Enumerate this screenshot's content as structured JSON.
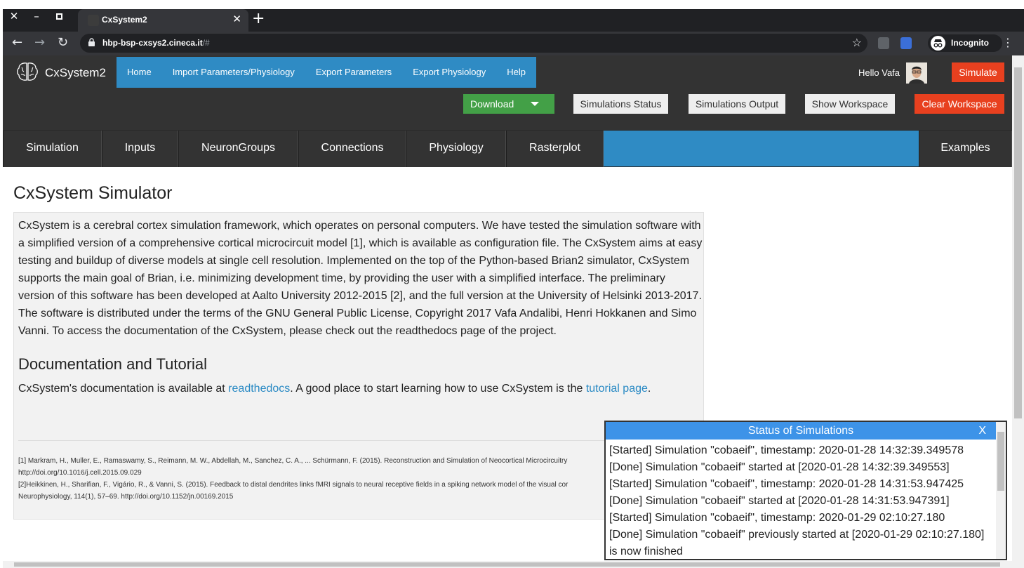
{
  "browser": {
    "tab_title": "CxSystem2",
    "url_host": "hbp-bsp-cxsys2.cineca.it",
    "url_rest": "/#",
    "profile_label": "Incognito"
  },
  "header": {
    "brand": "CxSystem2",
    "nav": [
      "Home",
      "Import Parameters/Physiology",
      "Export Parameters",
      "Export Physiology",
      "Help"
    ],
    "greeting": "Hello Vafa",
    "simulate_label": "Simulate",
    "download_label": "Download",
    "simulations_status_label": "Simulations Status",
    "simulations_output_label": "Simulations Output",
    "show_workspace_label": "Show Workspace",
    "clear_workspace_label": "Clear Workspace"
  },
  "tabs": [
    "Simulation",
    "Inputs",
    "NeuronGroups",
    "Connections",
    "Physiology",
    "Rasterplot"
  ],
  "examples_label": "Examples",
  "main": {
    "title": "CxSystem Simulator",
    "intro": "CxSystem is a cerebral cortex simulation framework, which operates on personal computers. We have tested the simulation software with a simplified version of a comprehensive cortical microcircuit model [1], which is available as configuration file. The CxSystem aims at easy testing and buildup of diverse models at single cell resolution. Implemented on the top of the Python-based Brian2 simulator, CxSystem supports the main goal of Brian, i.e. minimizing development time, by providing the user with a simplified interface. The preliminary version of this software has been developed at Aalto University 2012-2015 [2], and the full version at the University of Helsinki 2013-2017. The software is distributed under the terms of the GNU General Public License, Copyright 2017 Vafa Andalibi, Henri Hokkanen and Simo Vanni. To access the documentation of the CxSystem, please check out the readthedocs page of the project.",
    "doc_heading": "Documentation and Tutorial",
    "doc_text_1": "CxSystem's documentation is available at ",
    "doc_link_1": "readthedocs",
    "doc_text_2": ". A good place to start learning how to use CxSystem is the ",
    "doc_link_2": "tutorial page",
    "doc_text_3": ".",
    "refs": [
      "[1] Markram, H., Muller, E., Ramaswamy, S., Reimann, M. W., Abdellah, M., Sanchez, C. A., ... Schürmann, F. (2015). Reconstruction and Simulation of Neocortical Microcircuitry",
      "http://doi.org/10.1016/j.cell.2015.09.029",
      "[2]Heikkinen, H., Sharifian, F., Vigário, R., & Vanni, S. (2015). Feedback to distal dendrites links fMRI signals to neural receptive fields in a spiking network model of the visual cor",
      "Neurophysiology, 114(1), 57–69. http://doi.org/10.1152/jn.00169.2015"
    ]
  },
  "status_popup": {
    "title": "Status of Simulations",
    "close_label": "X",
    "lines": [
      "[Started] Simulation \"cobaeif\", timestamp: 2020-01-28 14:32:39.349578",
      "[Done] Simulation \"cobaeif\" started at [2020-01-28 14:32:39.349553]",
      "[Started] Simulation \"cobaeif\", timestamp: 2020-01-28 14:31:53.947425",
      "[Done] Simulation \"cobaeif\" started at [2020-01-28 14:31:53.947391]",
      "[Started] Simulation \"cobaeif\", timestamp: 2020-01-29 02:10:27.180",
      "[Done] Simulation \"cobaeif\" previously started at [2020-01-29 02:10:27.180]",
      "is now finished"
    ]
  },
  "colors": {
    "nav_blue": "#2f8bc4",
    "header_dark": "#333333",
    "danger_red": "#e8401f",
    "download_green": "#43a047",
    "popup_header_blue": "#3d93e8",
    "link_blue": "#2a8ac4"
  },
  "icons": [
    "close-icon",
    "minimize-icon",
    "maximize-icon",
    "back-icon",
    "forward-icon",
    "reload-icon",
    "lock-icon",
    "star-icon",
    "ublock-icon",
    "bitwarden-icon",
    "incognito-icon",
    "more-vert-icon",
    "brain-logo-icon",
    "caret-down-icon"
  ]
}
